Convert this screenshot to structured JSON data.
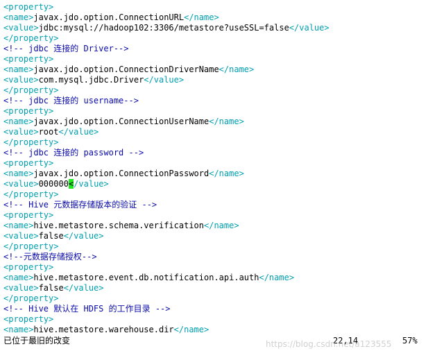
{
  "lines": [
    {
      "kind": "tag",
      "text": "<property>"
    },
    {
      "kind": "pair",
      "open": "<name>",
      "value": "javax.jdo.option.ConnectionURL",
      "close": "</name>"
    },
    {
      "kind": "pair",
      "open": "<value>",
      "value": "jdbc:mysql://hadoop102:3306/metastore?useSSL=false",
      "close": "</value>"
    },
    {
      "kind": "tag",
      "text": "</property>"
    },
    {
      "kind": "comment",
      "text": "<!-- jdbc 连接的 Driver-->"
    },
    {
      "kind": "tag",
      "text": "<property>"
    },
    {
      "kind": "pair",
      "open": "<name>",
      "value": "javax.jdo.option.ConnectionDriverName",
      "close": "</name>"
    },
    {
      "kind": "pair",
      "open": "<value>",
      "value": "com.mysql.jdbc.Driver",
      "close": "</value>"
    },
    {
      "kind": "tag",
      "text": "</property>"
    },
    {
      "kind": "comment",
      "text": "<!-- jdbc 连接的 username-->"
    },
    {
      "kind": "tag",
      "text": "<property>"
    },
    {
      "kind": "pair",
      "open": "<name>",
      "value": "javax.jdo.option.ConnectionUserName",
      "close": "</name>"
    },
    {
      "kind": "pair",
      "open": "<value>",
      "value": "root",
      "close": "</value>"
    },
    {
      "kind": "tag",
      "text": "</property>"
    },
    {
      "kind": "comment",
      "text": "<!-- jdbc 连接的 password -->"
    },
    {
      "kind": "tag",
      "text": "<property>"
    },
    {
      "kind": "pair",
      "open": "<name>",
      "value": "javax.jdo.option.ConnectionPassword",
      "close": "</name>"
    },
    {
      "kind": "cursorpair",
      "open": "<value>",
      "value": "000000",
      "cursor": "<",
      "close": "/value>"
    },
    {
      "kind": "tag",
      "text": "</property>"
    },
    {
      "kind": "comment",
      "text": "<!-- Hive 元数据存储版本的验证 -->"
    },
    {
      "kind": "tag",
      "text": "<property>"
    },
    {
      "kind": "pair",
      "open": "<name>",
      "value": "hive.metastore.schema.verification",
      "close": "</name>"
    },
    {
      "kind": "pair",
      "open": "<value>",
      "value": "false",
      "close": "</value>"
    },
    {
      "kind": "tag",
      "text": "</property>"
    },
    {
      "kind": "comment",
      "text": "<!--元数据存储授权-->"
    },
    {
      "kind": "tag",
      "text": "<property>"
    },
    {
      "kind": "pair",
      "open": "<name>",
      "value": "hive.metastore.event.db.notification.api.auth",
      "close": "</name>"
    },
    {
      "kind": "pair",
      "open": "<value>",
      "value": "false",
      "close": "</value>"
    },
    {
      "kind": "tag",
      "text": "</property>"
    },
    {
      "kind": "comment",
      "text": "<!-- Hive 默认在 HDFS 的工作目录 -->"
    },
    {
      "kind": "tag",
      "text": "<property>"
    },
    {
      "kind": "pair",
      "open": "<name>",
      "value": "hive.metastore.warehouse.dir",
      "close": "</name>"
    }
  ],
  "status": {
    "message": "已位于最旧的改变",
    "position": "22,14",
    "percent": "57%"
  },
  "watermark": "https://blog.csdn.net/a123555"
}
